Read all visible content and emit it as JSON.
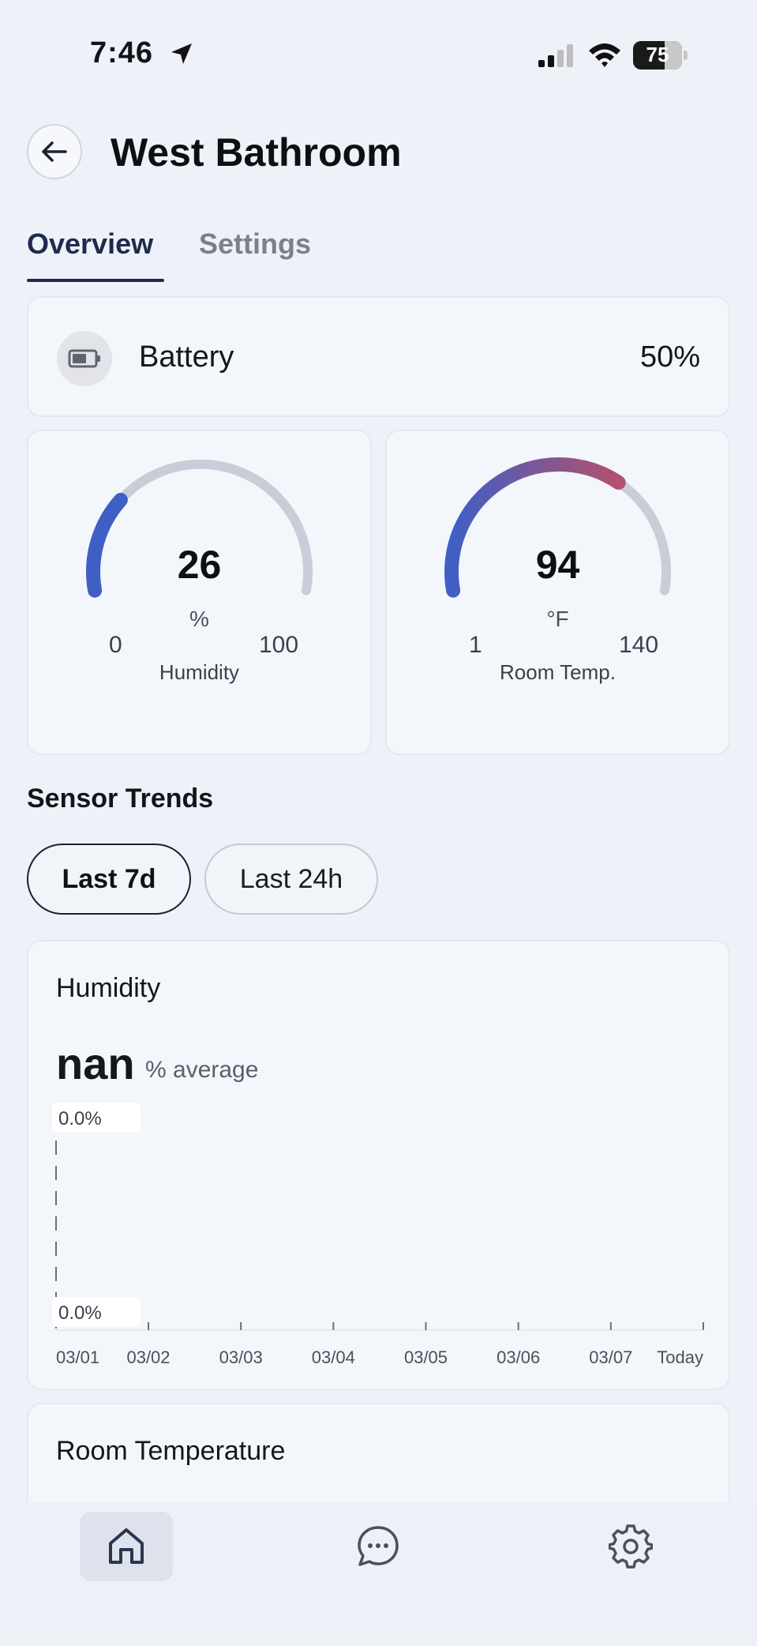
{
  "status_bar": {
    "time": "7:46",
    "battery_level": "75"
  },
  "header": {
    "title": "West Bathroom"
  },
  "tabs": [
    {
      "label": "Overview",
      "active": true
    },
    {
      "label": "Settings",
      "active": false
    }
  ],
  "battery": {
    "label": "Battery",
    "value": "50%"
  },
  "gauges": {
    "humidity": {
      "value": "26",
      "unit": "%",
      "min": "0",
      "max": "100",
      "label": "Humidity",
      "fraction": 0.26
    },
    "temp": {
      "value": "94",
      "unit": "°F",
      "min": "1",
      "max": "140",
      "label": "Room Temp.",
      "fraction": 0.669
    }
  },
  "trends": {
    "title": "Sensor Trends",
    "ranges": [
      {
        "label": "Last 7d",
        "selected": true
      },
      {
        "label": "Last 24h",
        "selected": false
      }
    ]
  },
  "humidity_chart": {
    "title": "Humidity",
    "average_value": "nan",
    "average_unit": "% average",
    "y_top_label": "0.0%",
    "y_bottom_label": "0.0%",
    "x_labels": [
      "03/01",
      "03/02",
      "03/03",
      "03/04",
      "03/05",
      "03/06",
      "03/07",
      "Today"
    ]
  },
  "temp_chart": {
    "title": "Room Temperature"
  },
  "colors": {
    "accent": "#3f5fc4",
    "gauge_track": "#c9cdd8",
    "gauge_warm": "#b4506f",
    "tab_active": "#1f2b4d"
  },
  "nav": {
    "items": [
      "home-icon",
      "chat-icon",
      "gear-icon"
    ]
  }
}
